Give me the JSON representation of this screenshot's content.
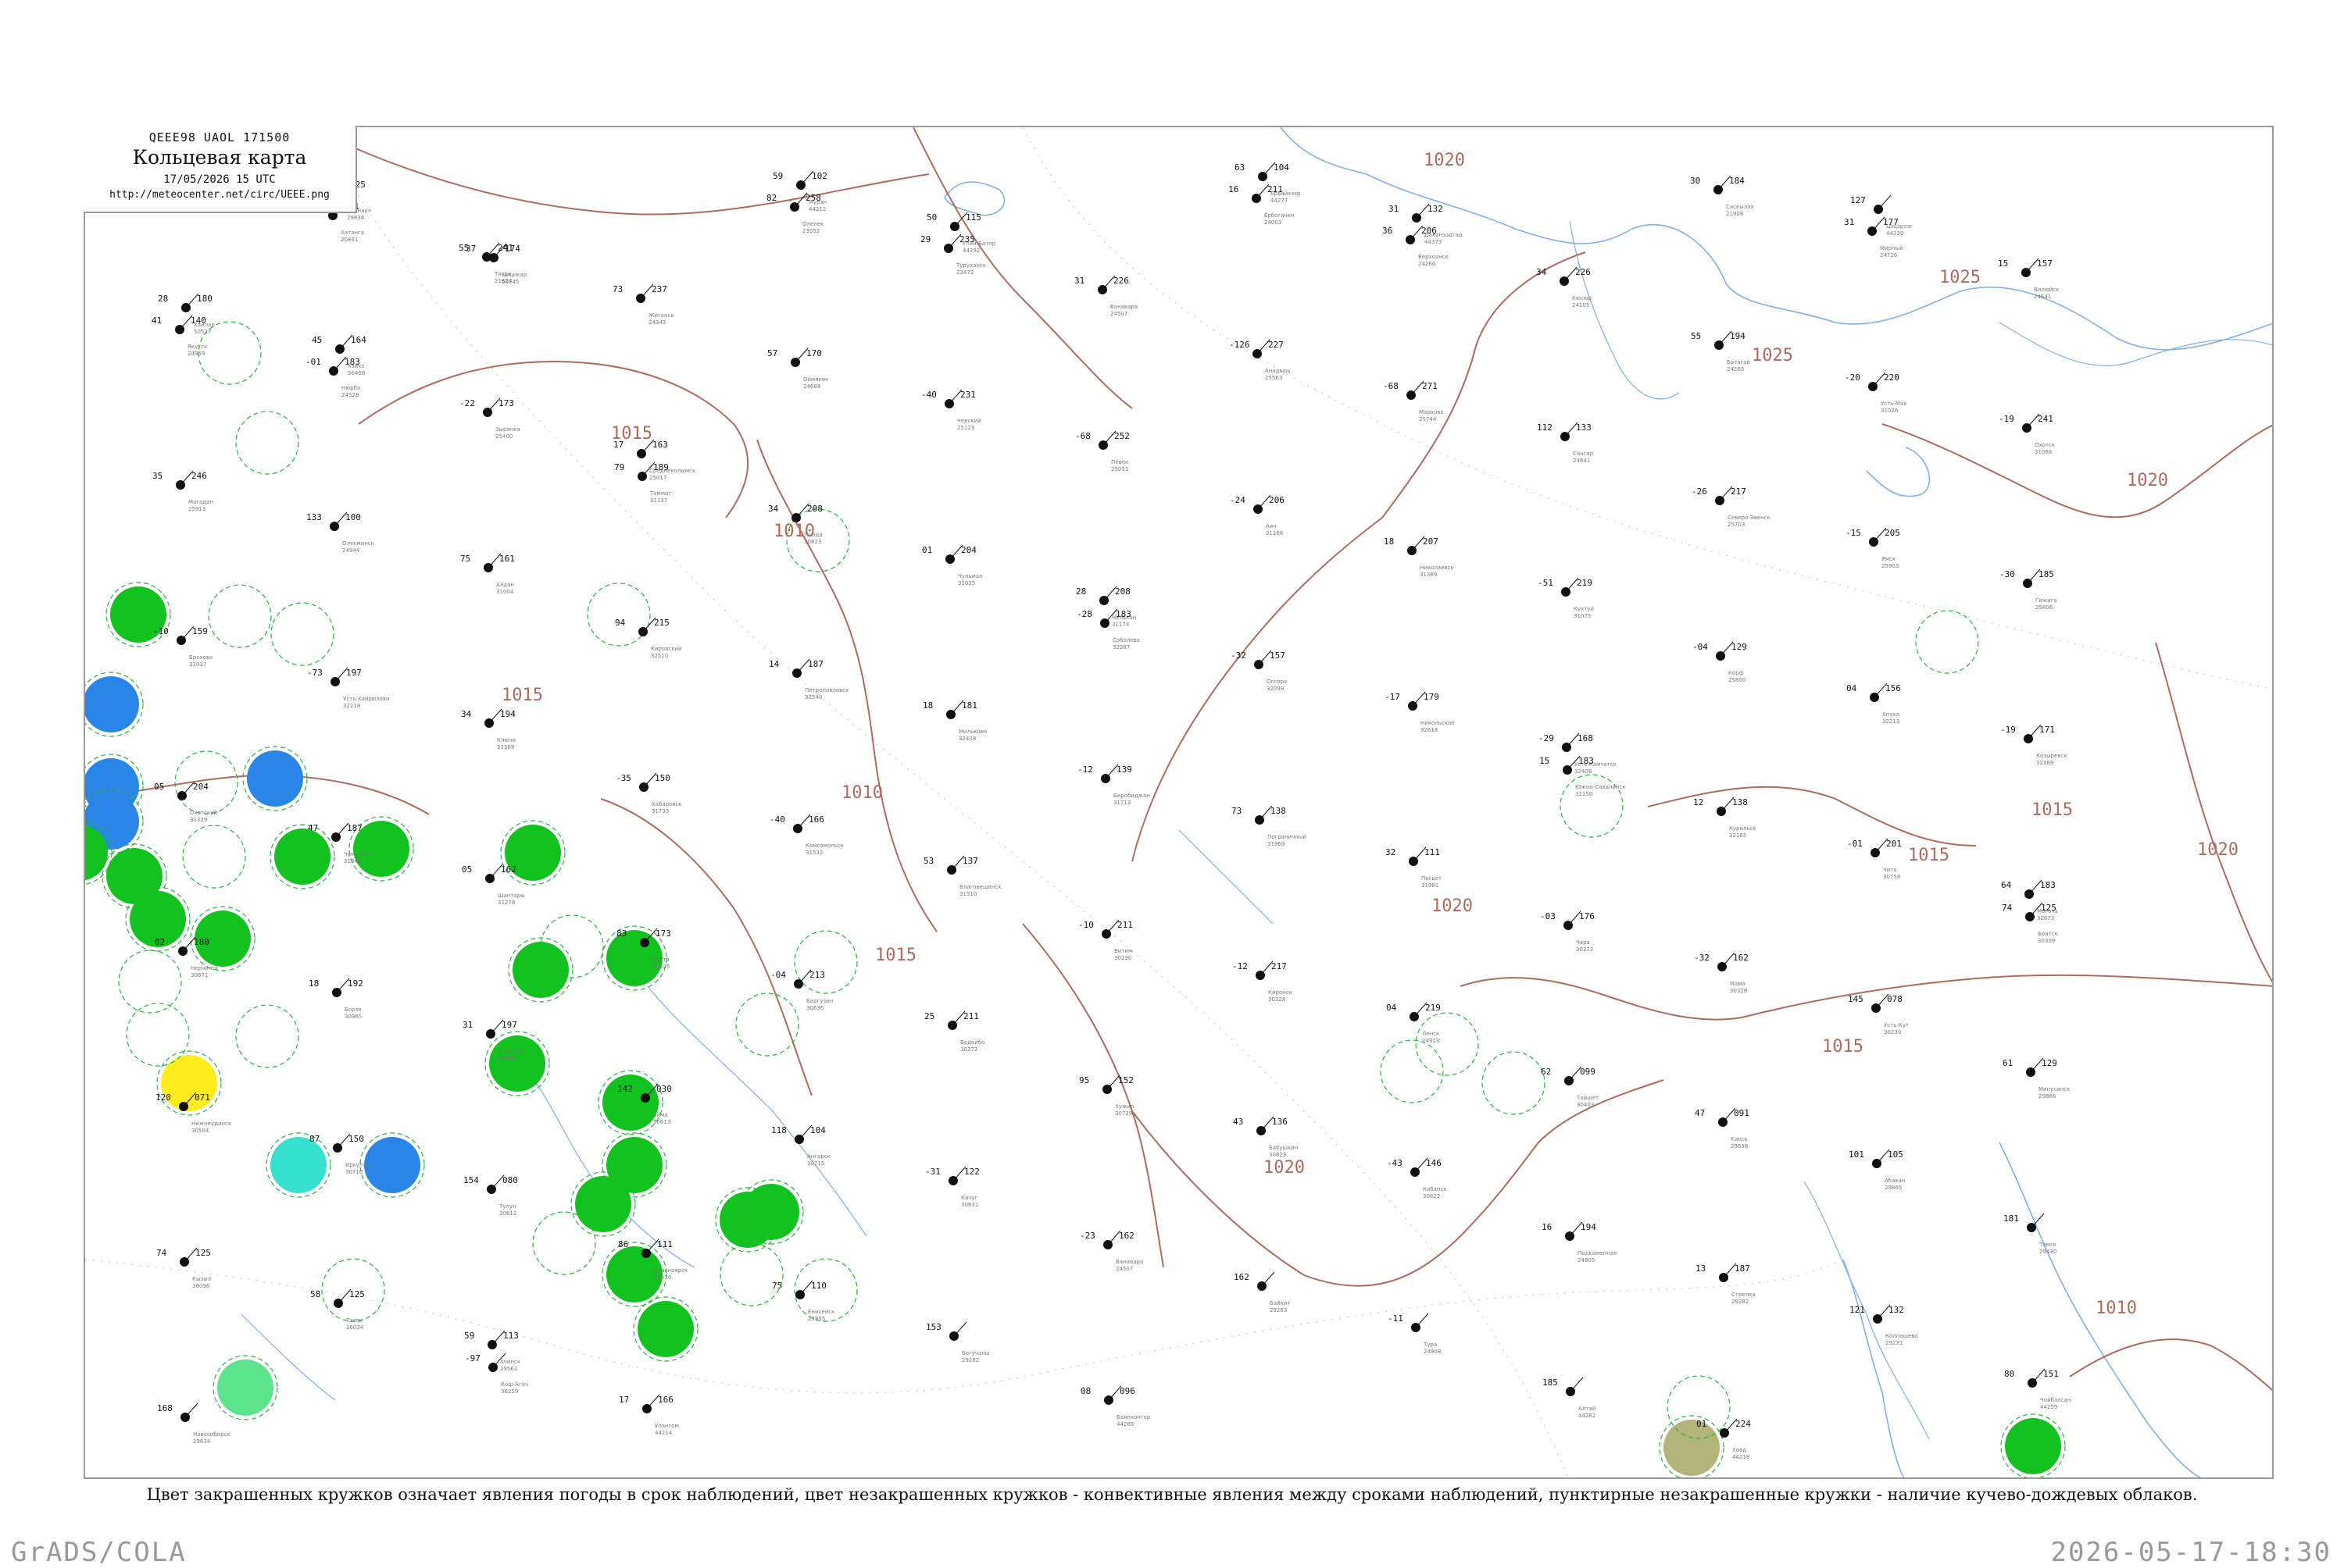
{
  "legend": {
    "code_line": "QEEE98  UAOL  171500",
    "title": "Кольцевая карта",
    "date": "17/05/2026 15 UTC",
    "url": "http://meteocenter.net/circ/UEEE.png"
  },
  "caption": "Цвет закрашенных кружков означает явления погоды в срок наблюдений, цвет незакрашенных кружков - конвективные явления между сроками наблюдений, пунктирные незакрашенные кружки - наличие кучево-дождевых облаков.",
  "footer": {
    "left": "GrADS/COLA",
    "right": "2026-05-17-18:30"
  },
  "colors": {
    "isobar": "#b06a5e",
    "river": "#7fb0e6",
    "border": "#9a9a9a",
    "green": "#12c21f",
    "blue": "#2a86e6",
    "cyan": "#35e0cf",
    "yellow": "#ffec1c",
    "olive": "#b3b47a",
    "lightgreen": "#5be48c",
    "dash": "#21b83a"
  },
  "isobar_labels": [
    "1020",
    "1015",
    "1020",
    "1025",
    "1025",
    "1020",
    "1015",
    "1010",
    "1015",
    "1010",
    "1015",
    "1020",
    "1020",
    "1015",
    "1015",
    "1020",
    "1010",
    "1015"
  ],
  "stations": [
    {
      "t": "-05",
      "p": "203",
      "name": "Сиктях",
      "id": "24"
    },
    {
      "t": "93",
      "p": "221",
      "name": "Хатанга",
      "id": "20891"
    },
    {
      "t": "55",
      "p": "241",
      "name": "Тикси",
      "id": "21824"
    },
    {
      "t": "73",
      "p": "237",
      "name": "Жиганск",
      "id": "24343"
    },
    {
      "t": "82",
      "p": "258",
      "name": "Оленек",
      "id": "23552"
    },
    {
      "t": "29",
      "p": "235",
      "name": "Туруханск",
      "id": "23472"
    },
    {
      "t": "31",
      "p": "226",
      "name": "Ванавара",
      "id": "24507"
    },
    {
      "t": "16",
      "p": "211",
      "name": "Ербогачен",
      "id": "24003"
    },
    {
      "t": "36",
      "p": "206",
      "name": "Верхоянск",
      "id": "24266"
    },
    {
      "t": "34",
      "p": "226",
      "name": "Кюсюр",
      "id": "24105"
    },
    {
      "t": "30",
      "p": "184",
      "name": "Саскылах",
      "id": "21908"
    },
    {
      "t": "31",
      "p": "177",
      "name": "Мирный",
      "id": "24726"
    },
    {
      "t": "15",
      "p": "157",
      "name": "Вилюйск",
      "id": "24641"
    },
    {
      "t": "41",
      "p": "140",
      "name": "Якутск",
      "id": "24959"
    },
    {
      "t": "-01",
      "p": "183",
      "name": "Нюрба",
      "id": "24528"
    },
    {
      "t": "-22",
      "p": "173",
      "name": "Зырянка",
      "id": "25400"
    },
    {
      "t": "17",
      "p": "163",
      "name": "Среднеколымск",
      "id": "25017"
    },
    {
      "t": "57",
      "p": "170",
      "name": "Оймякон",
      "id": "24688"
    },
    {
      "t": "-40",
      "p": "231",
      "name": "Черский",
      "id": "25123"
    },
    {
      "t": "-68",
      "p": "252",
      "name": "Певек",
      "id": "25051"
    },
    {
      "t": "-126",
      "p": "227",
      "name": "Анадырь",
      "id": "25563"
    },
    {
      "t": "-68",
      "p": "271",
      "name": "Марково",
      "id": "25744"
    },
    {
      "t": "112",
      "p": "133",
      "name": "Сангар",
      "id": "24641"
    },
    {
      "t": "55",
      "p": "194",
      "name": "Батагай",
      "id": "24266"
    },
    {
      "t": "-20",
      "p": "220",
      "name": "Усть-Мая",
      "id": "31026"
    },
    {
      "t": "-19",
      "p": "241",
      "name": "Охотск",
      "id": "31088"
    },
    {
      "t": "35",
      "p": "246",
      "name": "Магадан",
      "id": "25913"
    },
    {
      "t": "133",
      "p": "100",
      "name": "Олекминск",
      "id": "24944"
    },
    {
      "t": "75",
      "p": "161",
      "name": "Алдан",
      "id": "31004"
    },
    {
      "t": "79",
      "p": "189",
      "name": "Томмот",
      "id": "31137"
    },
    {
      "t": "34",
      "p": "208",
      "name": "Тында",
      "id": "30823"
    },
    {
      "t": "01",
      "p": "204",
      "name": "Чульман",
      "id": "31025"
    },
    {
      "t": "28",
      "p": "208",
      "name": "Нелькан",
      "id": "31174"
    },
    {
      "t": "-24",
      "p": "206",
      "name": "Аян",
      "id": "31168"
    },
    {
      "t": "18",
      "p": "207",
      "name": "Николаевск",
      "id": "31369"
    },
    {
      "t": "-51",
      "p": "219",
      "name": "Кухтуй",
      "id": "31075"
    },
    {
      "t": "-26",
      "p": "217",
      "name": "Северо-Эвенск",
      "id": "25703"
    },
    {
      "t": "-15",
      "p": "205",
      "name": "Ямск",
      "id": "25903"
    },
    {
      "t": "-30",
      "p": "185",
      "name": "Гижига",
      "id": "25806"
    },
    {
      "t": "-10",
      "p": "159",
      "name": "Брохово",
      "id": "32037"
    },
    {
      "t": "-73",
      "p": "197",
      "name": "Усть-Хайрюзово",
      "id": "32218"
    },
    {
      "t": "34",
      "p": "194",
      "name": "Ключи",
      "id": "32389"
    },
    {
      "t": "94",
      "p": "215",
      "name": "Кировский",
      "id": "32510"
    },
    {
      "t": "14",
      "p": "187",
      "name": "Петропавловск",
      "id": "32540"
    },
    {
      "t": "18",
      "p": "181",
      "name": "Мильково",
      "id": "32408"
    },
    {
      "t": "-28",
      "p": "183",
      "name": "Соболево",
      "id": "32287"
    },
    {
      "t": "-32",
      "p": "157",
      "name": "Оссора",
      "id": "32099"
    },
    {
      "t": "-17",
      "p": "179",
      "name": "Никольское",
      "id": "32618"
    },
    {
      "t": "-29",
      "p": "168",
      "name": "Усть-Камчатск",
      "id": "32408"
    },
    {
      "t": "-04",
      "p": "129",
      "name": "Корф",
      "id": "25800"
    },
    {
      "t": "04",
      "p": "156",
      "name": "Апука",
      "id": "32213"
    },
    {
      "t": "-19",
      "p": "171",
      "name": "Козыревск",
      "id": "32389"
    },
    {
      "t": "05",
      "p": "204",
      "name": "Охотский",
      "id": "31329"
    },
    {
      "t": "47",
      "p": "187",
      "name": "Чумикан",
      "id": "31348"
    },
    {
      "t": "05",
      "p": "162",
      "name": "Шантары",
      "id": "31278"
    },
    {
      "t": "-35",
      "p": "150",
      "name": "Хабаровск",
      "id": "31735"
    },
    {
      "t": "-40",
      "p": "166",
      "name": "Комсомольск",
      "id": "31532"
    },
    {
      "t": "53",
      "p": "137",
      "name": "Благовещенск",
      "id": "31510"
    },
    {
      "t": "-12",
      "p": "139",
      "name": "Биробиджан",
      "id": "31713"
    },
    {
      "t": "73",
      "p": "138",
      "name": "Пограничный",
      "id": "31969"
    },
    {
      "t": "32",
      "p": "111",
      "name": "Посьет",
      "id": "31981"
    },
    {
      "t": "15",
      "p": "183",
      "name": "Южно-Сахалинск",
      "id": "32150"
    },
    {
      "t": "12",
      "p": "138",
      "name": "Курильск",
      "id": "32165"
    },
    {
      "t": "-01",
      "p": "201",
      "name": "Чита",
      "id": "30758"
    },
    {
      "t": "64",
      "p": "183",
      "name": "Могоча",
      "id": "30673"
    },
    {
      "t": "02",
      "p": "180",
      "name": "Нерчинск",
      "id": "30871"
    },
    {
      "t": "18",
      "p": "192",
      "name": "Борзя",
      "id": "30965"
    },
    {
      "t": "31",
      "p": "197",
      "name": "Улан-Удэ",
      "id": "30823"
    },
    {
      "t": "83",
      "p": "173",
      "name": "Кяхта",
      "id": "30925"
    },
    {
      "t": "-04",
      "p": "213",
      "name": "Баргузин",
      "id": "30636"
    },
    {
      "t": "25",
      "p": "211",
      "name": "Бодайбо",
      "id": "30372"
    },
    {
      "t": "-10",
      "p": "211",
      "name": "Витим",
      "id": "30230"
    },
    {
      "t": "-12",
      "p": "217",
      "name": "Киренск",
      "id": "30328"
    },
    {
      "t": "04",
      "p": "219",
      "name": "Ленск",
      "id": "24923"
    },
    {
      "t": "-03",
      "p": "176",
      "name": "Чара",
      "id": "30372"
    },
    {
      "t": "-32",
      "p": "162",
      "name": "Мама",
      "id": "30328"
    },
    {
      "t": "145",
      "p": "078",
      "name": "Усть-Кут",
      "id": "30230"
    },
    {
      "t": "74",
      "p": "125",
      "name": "Братск",
      "id": "30309"
    },
    {
      "t": "120",
      "p": "071",
      "name": "Нижнеудинск",
      "id": "30504"
    },
    {
      "t": "87",
      "p": "150",
      "name": "Иркутск",
      "id": "30710"
    },
    {
      "t": "154",
      "p": "080",
      "name": "Тулун",
      "id": "30612"
    },
    {
      "t": "142",
      "p": "030",
      "name": "Зима",
      "id": "30613"
    },
    {
      "t": "118",
      "p": "104",
      "name": "Ангарск",
      "id": "30715"
    },
    {
      "t": "-31",
      "p": "122",
      "name": "Качуг",
      "id": "30631"
    },
    {
      "t": "95",
      "p": "152",
      "name": "Хужир",
      "id": "30729"
    },
    {
      "t": "43",
      "p": "136",
      "name": "Бабушкин",
      "id": "30823"
    },
    {
      "t": "-43",
      "p": "146",
      "name": "Кабанск",
      "id": "30822"
    },
    {
      "t": "62",
      "p": "099",
      "name": "Тайшет",
      "id": "30403"
    },
    {
      "t": "47",
      "p": "091",
      "name": "Канск",
      "id": "29698"
    },
    {
      "t": "101",
      "p": "105",
      "name": "Абакан",
      "id": "29865"
    },
    {
      "t": "61",
      "p": "129",
      "name": "Минусинск",
      "id": "29866"
    },
    {
      "t": "74",
      "p": "125",
      "name": "Кызыл",
      "id": "36096"
    },
    {
      "t": "58",
      "p": "125",
      "name": "Тээли",
      "id": "36034"
    },
    {
      "t": "59",
      "p": "113",
      "name": "Ачинск",
      "id": "29562"
    },
    {
      "t": "86",
      "p": "111",
      "name": "Красноярск",
      "id": "29570"
    },
    {
      "t": "75",
      "p": "110",
      "name": "Енисейск",
      "id": "23955"
    },
    {
      "t": "153",
      "p": "",
      "name": "Богучаны",
      "id": "29282"
    },
    {
      "t": "-23",
      "p": "162",
      "name": "Ванавара",
      "id": "24507"
    },
    {
      "t": "162",
      "p": "",
      "name": "Байкит",
      "id": "29263"
    },
    {
      "t": "-11",
      "p": "",
      "name": "Тура",
      "id": "24908"
    },
    {
      "t": "16",
      "p": "194",
      "name": "Подкаменная",
      "id": "24805"
    },
    {
      "t": "13",
      "p": "187",
      "name": "Стрелка",
      "id": "29282"
    },
    {
      "t": "121",
      "p": "132",
      "name": "Колпашево",
      "id": "29231"
    },
    {
      "t": "181",
      "p": "",
      "name": "Томск",
      "id": "29430"
    },
    {
      "t": "168",
      "p": "",
      "name": "Новосибирск",
      "id": "29634"
    },
    {
      "t": "74",
      "p": "125",
      "name": "Барнаул",
      "id": "29838"
    },
    {
      "t": "-97",
      "p": "",
      "name": "Кош-Агач",
      "id": "36259"
    },
    {
      "t": "17",
      "p": "166",
      "name": "Улангом",
      "id": "44214"
    },
    {
      "t": "59",
      "p": "102",
      "name": "Мурэн",
      "id": "44212"
    },
    {
      "t": "50",
      "p": "115",
      "name": "Улан-Батор",
      "id": "44292"
    },
    {
      "t": "08",
      "p": "096",
      "name": "Баянхонгор",
      "id": "44288"
    },
    {
      "t": "63",
      "p": "104",
      "name": "Арвайхээр",
      "id": "44277"
    },
    {
      "t": "31",
      "p": "132",
      "name": "Даланзадгад",
      "id": "44373"
    },
    {
      "t": "185",
      "p": "",
      "name": "Алтай",
      "id": "44282"
    },
    {
      "t": "01",
      "p": "224",
      "name": "Ховд",
      "id": "44218"
    },
    {
      "t": "127",
      "p": "",
      "name": "Цэцэрлэг",
      "id": "44239"
    },
    {
      "t": "80",
      "p": "151",
      "name": "Чойбалсан",
      "id": "44259"
    },
    {
      "t": "28",
      "p": "180",
      "name": "Хайлар",
      "id": "50527"
    },
    {
      "t": "45",
      "p": "164",
      "name": "Хэйхэ",
      "id": "50468"
    },
    {
      "t": "37",
      "p": "174",
      "name": "Цицикар",
      "id": "50745"
    }
  ],
  "colored_marks": [
    {
      "color": "green"
    },
    {
      "color": "green"
    },
    {
      "color": "green"
    },
    {
      "color": "green"
    },
    {
      "color": "green"
    },
    {
      "color": "green"
    },
    {
      "color": "green"
    },
    {
      "color": "green"
    },
    {
      "color": "green"
    },
    {
      "color": "green"
    },
    {
      "color": "green"
    },
    {
      "color": "green"
    },
    {
      "color": "green"
    },
    {
      "color": "green"
    },
    {
      "color": "green"
    },
    {
      "color": "green"
    },
    {
      "color": "green"
    },
    {
      "color": "green"
    },
    {
      "color": "blue"
    },
    {
      "color": "blue"
    },
    {
      "color": "blue"
    },
    {
      "color": "blue"
    },
    {
      "color": "blue"
    },
    {
      "color": "cyan"
    },
    {
      "color": "yellow"
    },
    {
      "color": "lightgreen"
    },
    {
      "color": "olive"
    },
    {
      "color": "green"
    }
  ]
}
